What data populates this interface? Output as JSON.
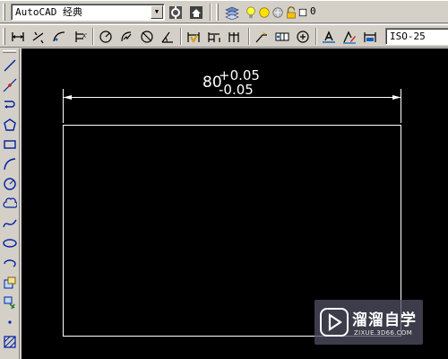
{
  "toolbar_top": {
    "workspace_select": "AutoCAD 经典",
    "layer_value": "0",
    "icons": [
      "workspace-settings-icon",
      "workspace-save-icon",
      "layer-manager-icon",
      "lightbulb-icon",
      "sun-icon",
      "freeze-icon",
      "lock-icon",
      "color-swatch-icon"
    ]
  },
  "toolbar_dim": {
    "dimstyle_select": "ISO-25",
    "icons": [
      "linear-dimension-icon",
      "aligned-dimension-icon",
      "arc-length-icon",
      "ordinate-dimension-icon",
      "radius-dimension-icon",
      "jogged-dimension-icon",
      "diameter-dimension-icon",
      "angular-dimension-icon",
      "quick-dimension-icon",
      "baseline-dimension-icon",
      "continue-dimension-icon",
      "quick-leader-icon",
      "tolerance-icon",
      "center-mark-icon",
      "dimension-edit-icon",
      "dimension-text-edit-icon",
      "dimension-update-icon"
    ]
  },
  "left_toolbar": {
    "icons": [
      "line-icon",
      "construction-line-icon",
      "polyline-icon",
      "polygon-icon",
      "rectangle-icon",
      "arc-icon",
      "circle-icon",
      "revision-cloud-icon",
      "spline-icon",
      "ellipse-icon",
      "ellipse-arc-icon",
      "insert-block-icon",
      "make-block-icon",
      "point-icon",
      "hatch-icon"
    ]
  },
  "drawing": {
    "dimension_value": "80",
    "upper_tolerance": "+0.05",
    "lower_tolerance": "-0.05"
  },
  "watermark": {
    "title": "溜溜自学",
    "subtitle": "ZIXUE.3D66.COM"
  },
  "colors": {
    "canvas_bg": "#000000",
    "geometry": "#ffffff",
    "chrome": "#d4d0c8"
  }
}
